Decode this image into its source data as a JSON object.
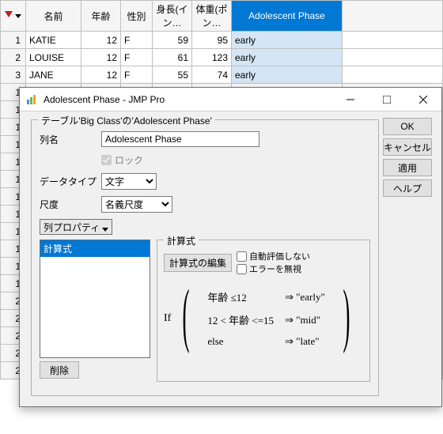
{
  "table": {
    "headers": [
      "名前",
      "年齢",
      "性別",
      "身長(イン…",
      "体重(ポン…",
      "Adolescent Phase"
    ],
    "rows": [
      {
        "n": "1",
        "name": "KATIE",
        "age": "12",
        "sex": "F",
        "h": "59",
        "w": "95",
        "phase": "early"
      },
      {
        "n": "2",
        "name": "LOUISE",
        "age": "12",
        "sex": "F",
        "h": "61",
        "w": "123",
        "phase": "early"
      },
      {
        "n": "3",
        "name": "JANE",
        "age": "12",
        "sex": "F",
        "h": "55",
        "w": "74",
        "phase": "early"
      }
    ],
    "blank_rows": [
      "1",
      "1",
      "1",
      "1",
      "1",
      "1",
      "1",
      "1",
      "1",
      "1",
      "1",
      "1",
      "2",
      "2",
      "2",
      "2",
      "2"
    ]
  },
  "dialog": {
    "title": "Adolescent Phase - JMP Pro",
    "group_title": "テーブル'Big Class'の'Adolescent Phase'",
    "colname_label": "列名",
    "colname_value": "Adolescent Phase",
    "lock_label": "ロック",
    "datatype_label": "データタイプ",
    "datatype_value": "文字",
    "scale_label": "尺度",
    "scale_value": "名義尺度",
    "prop_btn": "列プロパティ",
    "prop_item": "計算式",
    "delete_btn": "削除",
    "formula_title": "計算式",
    "edit_formula_btn": "計算式の編集",
    "auto_eval": "自動評価しない",
    "ignore_err": "エラーを無視",
    "if_word": "If",
    "cond1": "年齢 ≤12",
    "res1": "⇒ \"early\"",
    "cond2": "12 < 年齢 <=15",
    "res2": "⇒ \"mid\"",
    "cond3": "else",
    "res3": "⇒ \"late\"",
    "ok": "OK",
    "cancel": "キャンセル",
    "apply": "適用",
    "help": "ヘルプ"
  }
}
